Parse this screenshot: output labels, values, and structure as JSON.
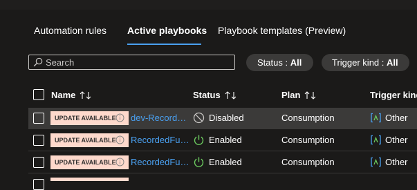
{
  "tabs": [
    {
      "label": "Automation rules"
    },
    {
      "label": "Active playbooks"
    },
    {
      "label": "Playbook templates (Preview)"
    }
  ],
  "search": {
    "placeholder": "Search"
  },
  "filters": [
    {
      "label": "Status : ",
      "value": "All"
    },
    {
      "label": "Trigger kind : ",
      "value": "All"
    }
  ],
  "table": {
    "headers": {
      "name": "Name",
      "status": "Status",
      "plan": "Plan",
      "trigger": "Trigger kind"
    },
    "rows": [
      {
        "badge": "UPDATE AVAILABLE",
        "name": "dev-RecordedFuture",
        "status": "Disabled",
        "plan": "Consumption",
        "trigger": "Other"
      },
      {
        "badge": "UPDATE AVAILABLE",
        "name": "RecordedFuture",
        "status": "Enabled",
        "plan": "Consumption",
        "trigger": "Other"
      },
      {
        "badge": "UPDATE AVAILABLE",
        "name": "RecordedFuture",
        "status": "Enabled",
        "plan": "Consumption",
        "trigger": "Other"
      }
    ]
  },
  "colors": {
    "accent": "#4aa0f0",
    "badge": "#fed9cc",
    "enabled": "#6ccb5f",
    "background": "#1b1a19"
  },
  "icons": {
    "search": "search-icon",
    "info": "info-icon",
    "disabled": "disabled-icon",
    "enabled": "power-icon",
    "trigger": "api-connection-icon",
    "sort": "sort-icon"
  }
}
